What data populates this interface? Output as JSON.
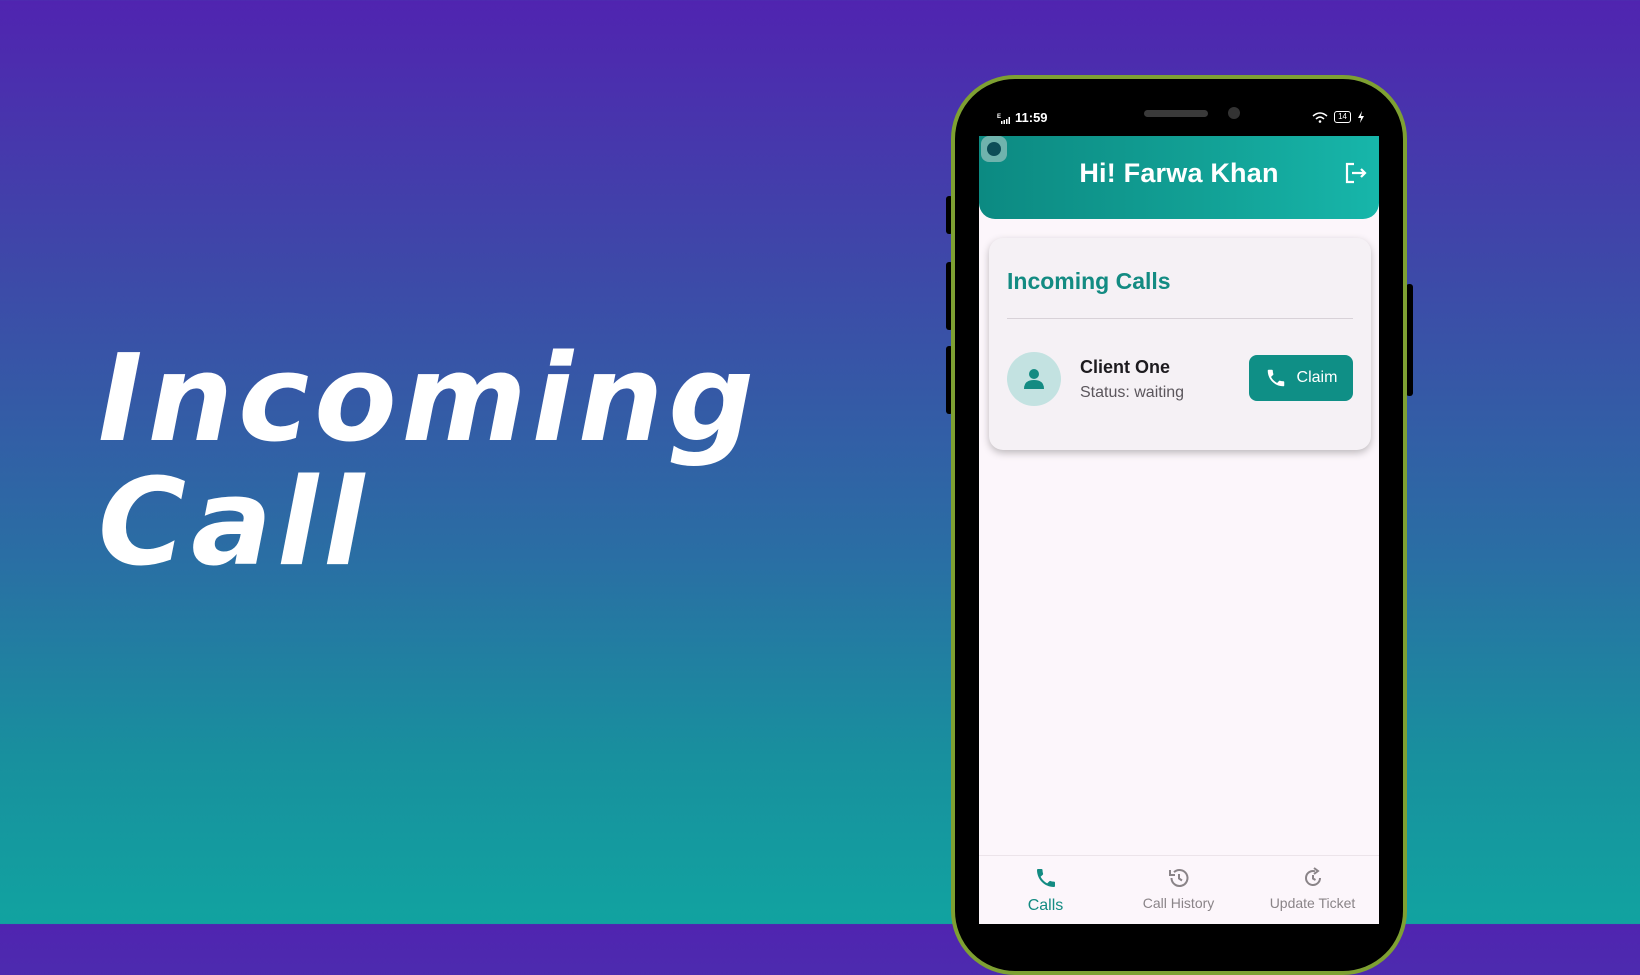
{
  "hero": {
    "line1": "Incoming",
    "line2": "Call"
  },
  "statusbar": {
    "time": "11:59",
    "battery": "14"
  },
  "app": {
    "greeting": "Hi! Farwa Khan",
    "section_title": "Incoming Calls",
    "calls": [
      {
        "name": "Client One",
        "status": "Status: waiting",
        "action": "Claim"
      }
    ]
  },
  "bottom_nav": [
    {
      "label": "Calls",
      "icon": "phone-icon",
      "active": true
    },
    {
      "label": "Call History",
      "icon": "history-icon",
      "active": false
    },
    {
      "label": "Update Ticket",
      "icon": "refresh-icon",
      "active": false
    }
  ],
  "colors": {
    "accent": "#138b82",
    "frame": "#7ea032",
    "background_top": "#5024b0",
    "background_bottom": "#11a3a0"
  }
}
